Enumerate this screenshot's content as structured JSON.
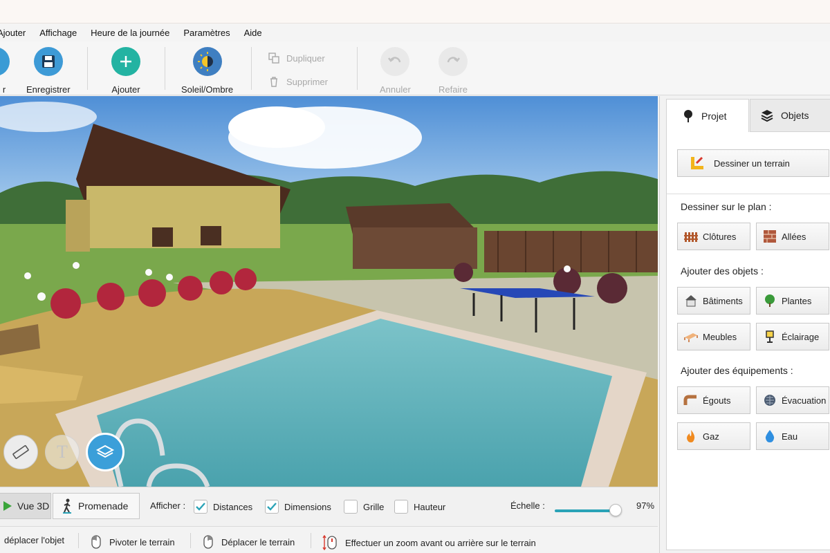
{
  "menu": [
    "Ajouter",
    "Affichage",
    "Heure de la journée",
    "Paramètres",
    "Aide"
  ],
  "toolbar": {
    "partial_label": "r",
    "save_label": "Enregistrer",
    "add_label": "Ajouter",
    "sun_label": "Soleil/Ombre",
    "duplicate_label": "Dupliquer",
    "delete_label": "Supprimer",
    "undo_label": "Annuler",
    "redo_label": "Refaire"
  },
  "tabs": {
    "project": "Projet",
    "objects": "Objets",
    "active": "Projet"
  },
  "panel": {
    "draw_terrain": "Dessiner un terrain",
    "section_plan": "Dessiner sur le plan :",
    "fences": "Clôtures",
    "paths": "Allées",
    "section_objects": "Ajouter des objets :",
    "buildings": "Bâtiments",
    "plants": "Plantes",
    "furniture": "Meubles",
    "lighting": "Éclairage",
    "section_equipment": "Ajouter des équipements :",
    "sewers": "Égouts",
    "drainage": "Évacuation",
    "gas": "Gaz",
    "water": "Eau"
  },
  "view": {
    "view3d": "Vue 3D",
    "walk": "Promenade",
    "show_label": "Afficher :",
    "distances": "Distances",
    "distances_checked": true,
    "dimensions": "Dimensions",
    "dimensions_checked": true,
    "grid": "Grille",
    "grid_checked": false,
    "height": "Hauteur",
    "height_checked": false,
    "scale_label": "Échelle :",
    "scale_value": "97%",
    "scale_fraction": 0.97
  },
  "hints": {
    "move_object": "déplacer l'objet",
    "rotate": "Pivoter le terrain",
    "pan": "Déplacer le terrain",
    "zoom": "Effectuer un zoom avant ou arrière sur le terrain"
  },
  "colors": {
    "accent_teal": "#2aa3b7",
    "save_blue": "#3d9ad6",
    "add_teal": "#23b3a2",
    "layers_blue": "#3b9fd9"
  }
}
